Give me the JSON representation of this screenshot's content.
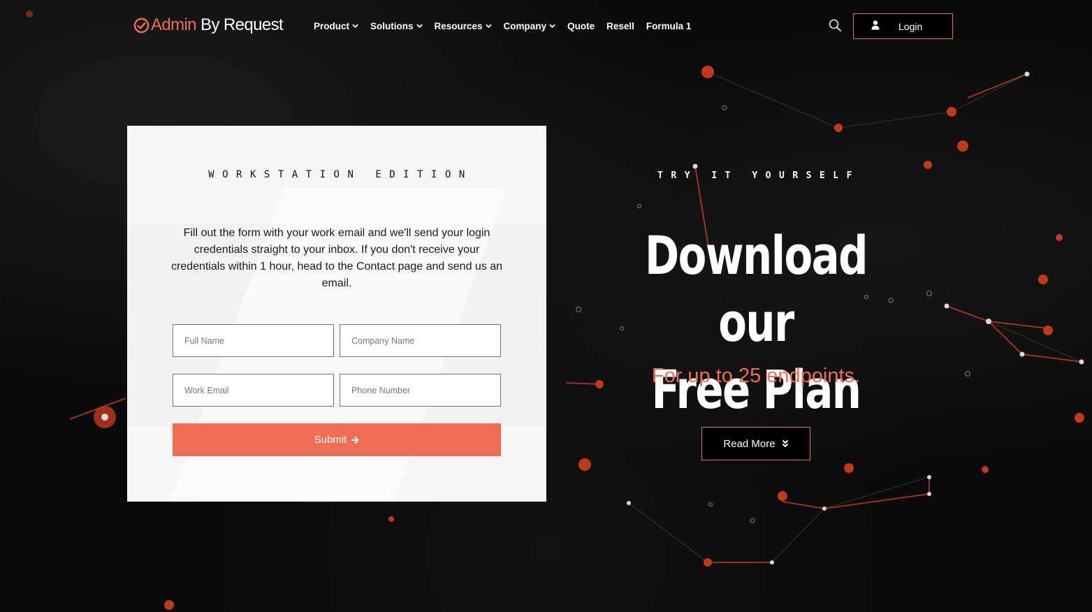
{
  "brand": {
    "name_accent": "Admin",
    "name_rest": "By Request",
    "logo_icon": "check-circle-icon",
    "accent_color": "#ef6d55"
  },
  "nav": {
    "items": [
      {
        "label": "Product",
        "has_dropdown": true
      },
      {
        "label": "Solutions",
        "has_dropdown": true
      },
      {
        "label": "Resources",
        "has_dropdown": true
      },
      {
        "label": "Company",
        "has_dropdown": true
      },
      {
        "label": "Quote",
        "has_dropdown": false
      },
      {
        "label": "Resell",
        "has_dropdown": false
      },
      {
        "label": "Formula 1",
        "has_dropdown": false
      }
    ],
    "search_icon": "search-icon",
    "login_label": "Login",
    "login_icon": "user-icon"
  },
  "form": {
    "eyebrow": "WORKSTATION EDITION",
    "description": "Fill out the form with your work email and we'll send your login credentials straight to your inbox. If you don't receive your credentials within 1 hour, head to the Contact page and send us an email.",
    "fields": {
      "full_name": {
        "placeholder": "Full Name",
        "value": ""
      },
      "company_name": {
        "placeholder": "Company Name",
        "value": ""
      },
      "work_email": {
        "placeholder": "Work Email",
        "value": ""
      },
      "phone_number": {
        "placeholder": "Phone Number",
        "value": ""
      }
    },
    "submit_label": "Submit",
    "submit_icon": "arrow-right-icon"
  },
  "hero": {
    "eyebrow": "TRY IT YOURSELF",
    "headline_line1": "Download our",
    "headline_line2": "Free Plan",
    "subheadline": "For up to 25 endpoints.",
    "cta_label": "Read More",
    "cta_icon": "double-chevron-down-icon"
  }
}
